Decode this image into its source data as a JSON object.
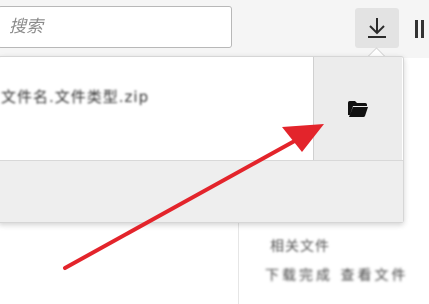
{
  "search": {
    "placeholder": "搜索"
  },
  "toolbar": {
    "download_icon": "download-arrow-icon",
    "library_icon": "library-icon"
  },
  "downloads_panel": {
    "items": [
      {
        "filename": "文件名.文件类型.zip",
        "open_folder_icon": "folder-icon"
      }
    ]
  },
  "background": {
    "line1": "相关文件",
    "line2": "下载完成 查看文件"
  },
  "annotation": {
    "arrow_color": "#e3242b"
  }
}
